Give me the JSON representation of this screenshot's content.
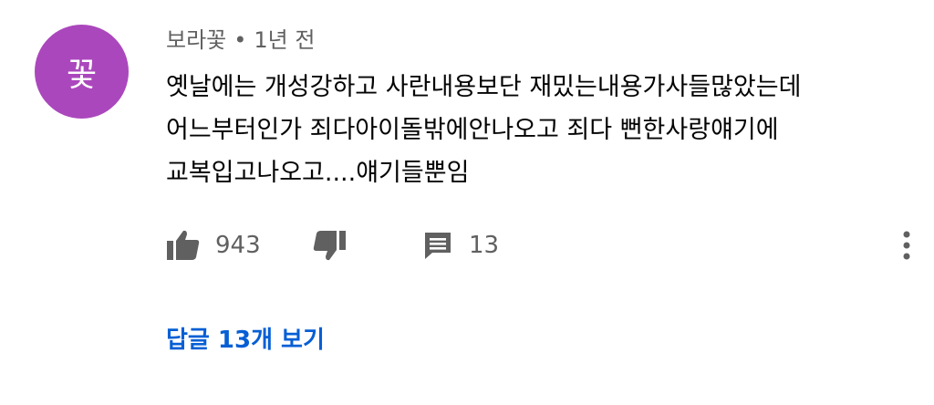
{
  "comment": {
    "avatar_text": "꽃",
    "avatar_color": "#ab47bc",
    "author": "보라꽃",
    "separator": "•",
    "timestamp": "1년 전",
    "body": "옛날에는 개성강하고 사란내용보단 재밌는내용가사들많았는데 어느부터인가 죄다아이돌밖에안나오고 죄다 뻔한사랑얘기에 교복입고나오고....얘기들뿐임",
    "like_count": "943",
    "reply_count": "13",
    "view_replies_label": "답글 13개 보기",
    "icons": {
      "like": "thumb-up-icon",
      "dislike": "thumb-down-icon",
      "reply": "comment-icon",
      "menu": "more-vertical-icon"
    },
    "colors": {
      "link": "#065fd4",
      "secondary_text": "#606060",
      "primary_text": "#030303"
    }
  }
}
